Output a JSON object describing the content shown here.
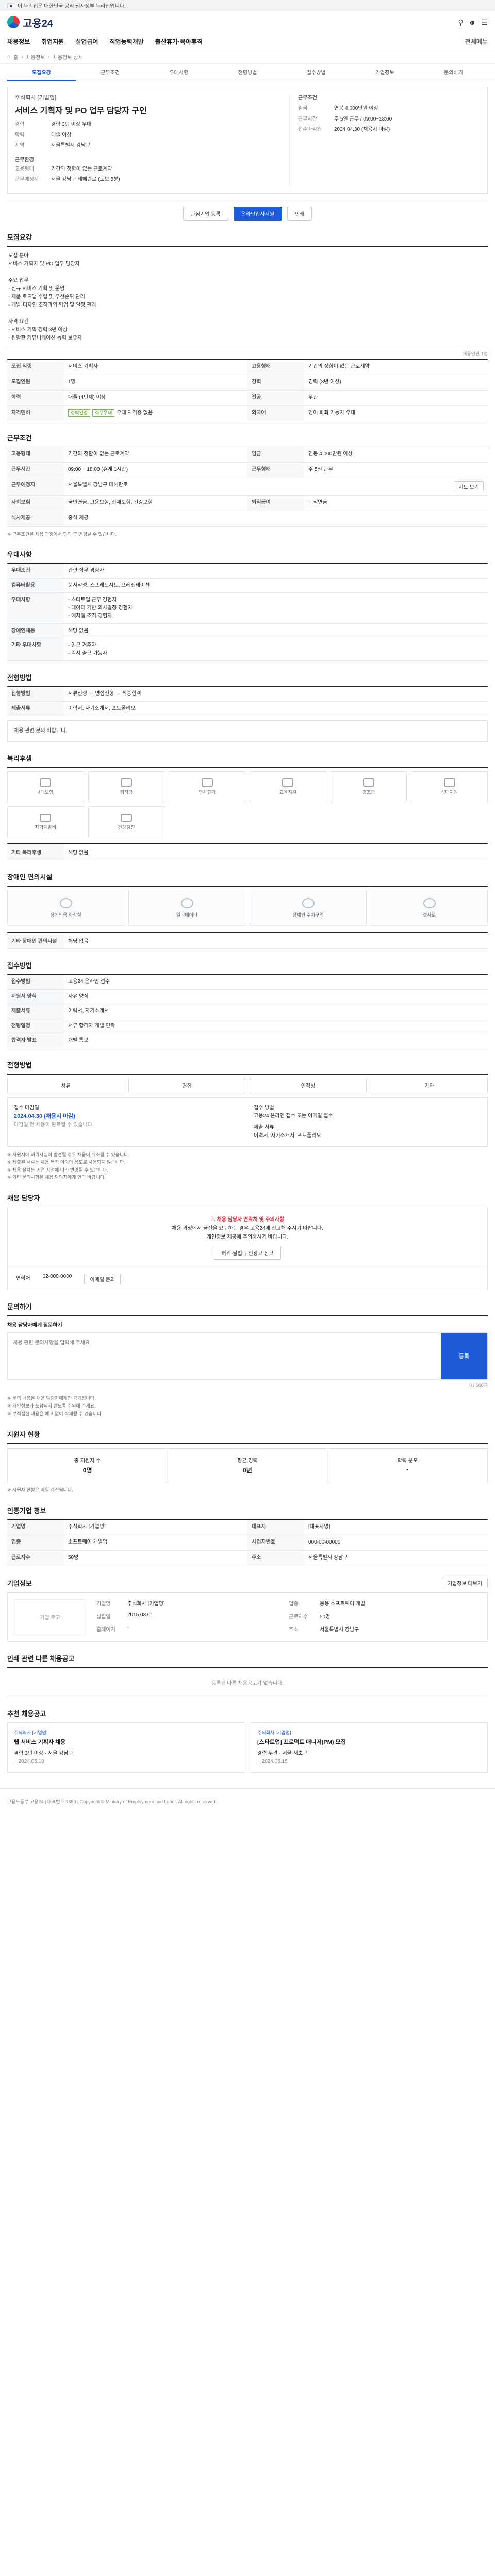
{
  "gov_banner": "이 누리집은 대한민국 공식 전자정부 누리집입니다.",
  "logo": "고용24",
  "header_icons": [
    "search-icon",
    "user-icon",
    "menu-icon"
  ],
  "gnb": [
    "채용정보",
    "취업지원",
    "실업급여",
    "직업능력개발",
    "출산휴가·육아휴직",
    "전체메뉴"
  ],
  "crumb": [
    "홈",
    "채용정보",
    "채용정보 상세"
  ],
  "tabs": [
    "모집요강",
    "근무조건",
    "우대사항",
    "전형방법",
    "접수방법",
    "기업정보",
    "문의하기"
  ],
  "hero": {
    "company": "주식회사 [기업명]",
    "title": "서비스 기획자 및 PO 업무 담당자 구인",
    "left_k": [
      "경력",
      "학력",
      "지역"
    ],
    "left_v": [
      "경력 3년 이상 우대",
      "대졸 이상",
      "서울특별시 강남구"
    ],
    "left_sec": "근무환경",
    "left_k2": [
      "고용형태",
      "근무예정지"
    ],
    "left_v2": [
      "기간의 정함이 없는 근로계약",
      "서울 강남구 테헤란로 (도보 5분)"
    ],
    "right_sec": "근무조건",
    "right_k": [
      "임금",
      "근무시간",
      "접수마감일"
    ],
    "right_v": [
      "연봉 4,000만원 이상",
      "주 5일 근무 / 09:00~18:00",
      "2024.04.30 (채용시 마감)"
    ],
    "btn_apply": "온라인입사지원",
    "btn_scrap": "관심기업 등록",
    "btn_print": "인쇄"
  },
  "sec_recruit": "모집요강",
  "recruit_text": "모집 분야\n서비스 기획자 및 PO 업무 담당자\n\n주요 업무\n- 신규 서비스 기획 및 운영\n- 제품 로드맵 수립 및 우선순위 관리\n- 개발·디자인 조직과의 협업 및 일정 관리\n\n자격 요건\n- 서비스 기획 경력 3년 이상\n- 원활한 커뮤니케이션 능력 보유자",
  "recruit_note": "채용인원 1명",
  "grid1_k": [
    "모집 직종",
    "고용형태",
    "모집인원",
    "경력",
    "학력",
    "전공",
    "자격면허",
    "외국어"
  ],
  "grid1_v": [
    "서비스 기획자",
    "기간의 정함이 없는 근로계약",
    "1명",
    "경력 (3년 이상)",
    "대졸 (4년제) 이상",
    "무관",
    "우대 자격증 없음",
    "영어 회화 가능자 우대"
  ],
  "grid1_chips": [
    "경력인정",
    "직무우대"
  ],
  "sec_work": "근무조건",
  "grid2_k": [
    "고용형태",
    "임금",
    "근무시간",
    "근무형태",
    "근무예정지",
    "사회보험",
    "퇴직급여",
    "식사제공"
  ],
  "grid2_v": [
    "기간의 정함이 없는 근로계약",
    "연봉 4,000만원 이상",
    "09:00 ~ 18:00 (휴게 1시간)",
    "주 5일 근무",
    "서울특별시 강남구 테헤란로",
    "국민연금, 고용보험, 산재보험, 건강보험",
    "퇴직연금",
    "중식 제공"
  ],
  "btn_map": "지도 보기",
  "work_note": "※ 근무조건은 채용 과정에서 협의 후 변경될 수 있습니다.",
  "sec_pref": "우대사항",
  "pref_k": [
    "우대조건",
    "컴퓨터활용",
    "우대사항",
    "장애인채용",
    "기타 우대사항"
  ],
  "pref_v": [
    "관련 직무 경험자",
    "문서작성, 스프레드시트, 프레젠테이션",
    "- 스타트업 근무 경험자\n- 데이터 기반 의사결정 경험자\n- 애자일 조직 경험자",
    "해당 없음",
    "- 인근 거주자\n- 즉시 출근 가능자"
  ],
  "sec_screen": "전형방법",
  "screen_k": [
    "전형방법",
    "제출서류"
  ],
  "screen_v": [
    "서류전형 → 면접전형 → 최종합격",
    "이력서, 자기소개서, 포트폴리오"
  ],
  "screen_ref": "채용 관련 문의 바랍니다.",
  "sec_welfare": "복리후생",
  "welfare": [
    "4대보험",
    "퇴직금",
    "연차휴가",
    "교육지원",
    "경조금",
    "식대지원",
    "자기계발비",
    "건강검진"
  ],
  "welfare_note_k": "기타 복리후생",
  "welfare_note_v": "해당 없음",
  "sec_disabled": "장애인 편의시설",
  "disabled": [
    "장애인용 화장실",
    "엘리베이터",
    "장애인 주차구역",
    "경사로"
  ],
  "disabled_note_k": "기타 장애인 편의시설",
  "disabled_note_v": "해당 없음",
  "sec_apply": "접수방법",
  "apply_k": [
    "접수방법",
    "지원서 양식",
    "제출서류",
    "전형일정",
    "합격자 발표"
  ],
  "apply_v": [
    "고용24 온라인 접수",
    "자유 양식",
    "이력서, 자기소개서",
    "서류 합격자 개별 연락",
    "개별 통보"
  ],
  "sec_method": "전형방법",
  "methods": [
    "서류",
    "면접",
    "인적성",
    "기타"
  ],
  "deadline": {
    "label": "접수 마감일",
    "date": "2024.04.30 (채용시 마감)",
    "note": "마감일 전 채용이 완료될 수 있습니다.",
    "label2": "접수 방법",
    "value2": "고용24 온라인 접수 또는 이메일 접수",
    "label3": "제출 서류",
    "value3": "이력서, 자기소개서, 포트폴리오"
  },
  "apply_bullets": [
    "※ 지원서에 허위사실이 발견될 경우 채용이 취소될 수 있습니다.",
    "※ 제출된 서류는 채용 목적 이외의 용도로 사용되지 않습니다.",
    "※ 채용 절차는 기업 사정에 따라 변경될 수 있습니다.",
    "※ 기타 문의사항은 채용 담당자에게 연락 바랍니다."
  ],
  "sec_contact": "채용 담당자",
  "warn_title": "채용 담당자 연락처 및 주의사항",
  "warn_text": "채용 과정에서 금전을 요구하는 경우 고용24에 신고해 주시기 바랍니다.\n개인정보 제공에 주의하시기 바랍니다.",
  "btn_report": "허위·불법 구인광고 신고",
  "contact_k": "연락처",
  "contact_v": "02-000-0000",
  "btn_email": "이메일 문의",
  "sec_qa": "문의하기",
  "qa_label": "채용 담당자에게 질문하기",
  "qa_placeholder": "채용 관련 문의사항을 입력해 주세요.",
  "qa_btn": "등록",
  "qa_counter": "0 / 500자",
  "qa_bullets": [
    "※ 문의 내용은 채용 담당자에게만 공개됩니다.",
    "※ 개인정보가 포함되지 않도록 주의해 주세요.",
    "※ 부적절한 내용은 예고 없이 삭제될 수 있습니다."
  ],
  "sec_stats": "지원자 현황",
  "stats": [
    {
      "label": "총 지원자 수",
      "value": "0명"
    },
    {
      "label": "평균 경력",
      "value": "0년"
    },
    {
      "label": "학력 분포",
      "value": "-"
    }
  ],
  "stats_note": "※ 지원자 현황은 매일 갱신됩니다.",
  "sec_recruiter": "인증기업 정보",
  "recruiter_k": [
    "기업명",
    "대표자",
    "업종",
    "사업자번호",
    "근로자수",
    "주소"
  ],
  "recruiter_v": [
    "주식회사 [기업명]",
    "[대표자명]",
    "소프트웨어 개발업",
    "000-00-00000",
    "50명",
    "서울특별시 강남구"
  ],
  "sec_company": "기업정보",
  "company_logo": "기업 로고",
  "company_k": [
    "기업명",
    "업종",
    "설립일",
    "근로자수",
    "홈페이지",
    "주소"
  ],
  "company_v": [
    "주식회사 [기업명]",
    "응용 소프트웨어 개발",
    "2015.03.01",
    "50명",
    "-",
    "서울특별시 강남구"
  ],
  "btn_company": "기업정보 더보기",
  "sec_other": "인쇄 관련 다른 채용공고",
  "other_empty": "등록된 다른 채용공고가 없습니다.",
  "sec_rec": "추천 채용공고",
  "rec": [
    {
      "company": "주식회사 [기업명]",
      "title": "웹 서비스 기획자 채용",
      "cond": "경력 3년 이상 · 서울 강남구",
      "deadline": "~ 2024.05.10"
    },
    {
      "company": "주식회사 [기업명]",
      "title": "[스타트업] 프로덕트 매니저(PM) 모집",
      "cond": "경력 무관 · 서울 서초구",
      "deadline": "~ 2024.05.15"
    }
  ],
  "footer": "고용노동부 고용24 | 대표번호 1350 | Copyright © Ministry of Employment and Labor. All rights reserved."
}
